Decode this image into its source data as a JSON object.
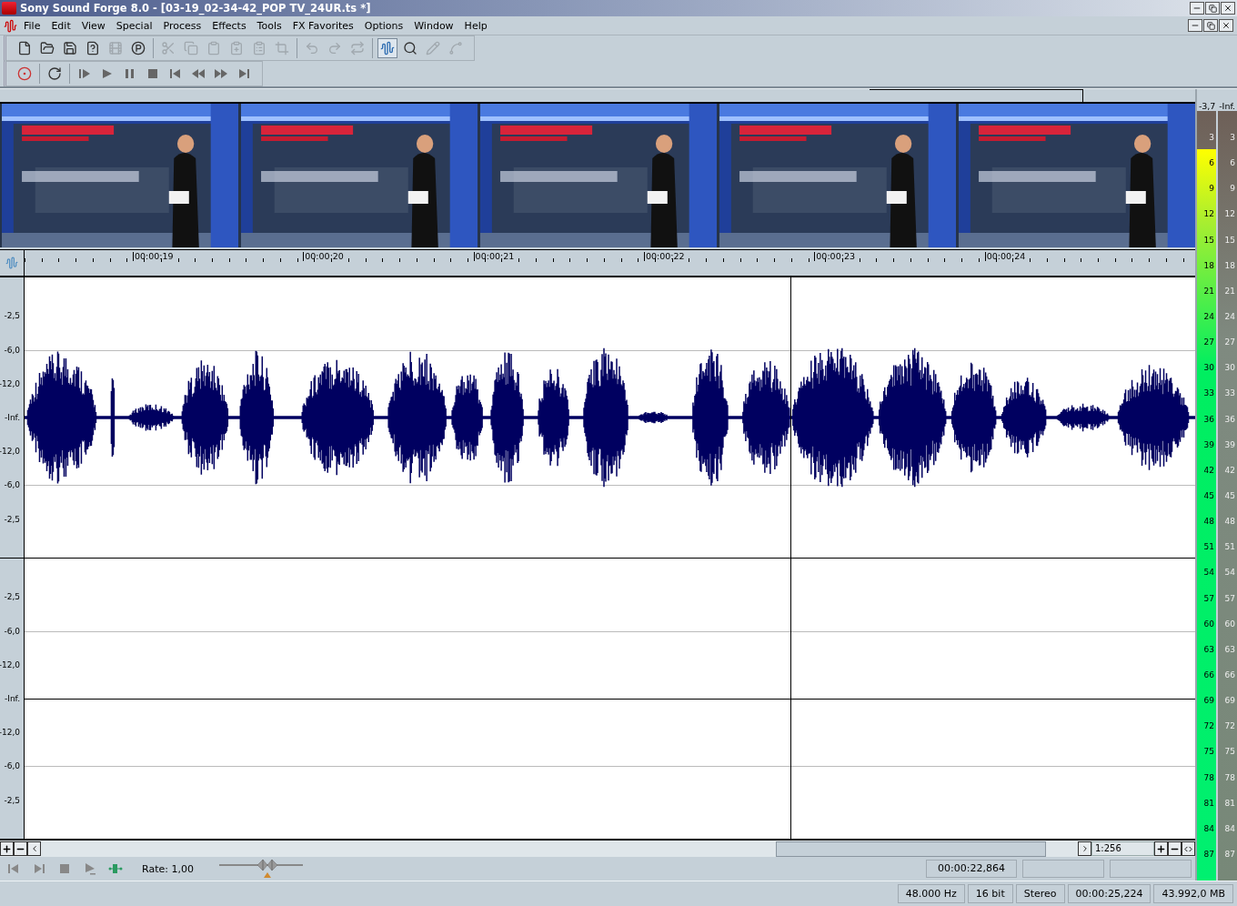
{
  "title_bar": {
    "title": "Sony Sound Forge 8.0 - [03-19_02-34-42_POP TV_24UR.ts *]"
  },
  "menu": [
    "File",
    "Edit",
    "View",
    "Special",
    "Process",
    "Effects",
    "Tools",
    "FX Favorites",
    "Options",
    "Window",
    "Help"
  ],
  "toolbar_rows": [
    [
      {
        "kind": "buttons",
        "items": [
          {
            "kind": "new",
            "disabled": false
          },
          {
            "kind": "open",
            "disabled": false
          },
          {
            "kind": "save",
            "disabled": false
          },
          {
            "kind": "saveas",
            "disabled": false
          },
          {
            "kind": "render",
            "disabled": true
          },
          {
            "kind": "properties",
            "disabled": false
          }
        ]
      },
      {
        "kind": "buttons",
        "items": [
          {
            "kind": "cut",
            "disabled": true
          },
          {
            "kind": "copy",
            "disabled": true
          },
          {
            "kind": "paste",
            "disabled": true
          },
          {
            "kind": "pastemix",
            "disabled": true
          },
          {
            "kind": "pastecross",
            "disabled": true
          },
          {
            "kind": "trim",
            "disabled": true
          }
        ]
      },
      {
        "kind": "buttons",
        "items": [
          {
            "kind": "undo",
            "disabled": true
          },
          {
            "kind": "redo",
            "disabled": true
          },
          {
            "kind": "repeat",
            "disabled": true
          }
        ]
      },
      {
        "kind": "tools",
        "items": [
          {
            "kind": "edit",
            "disabled": false,
            "selected": true
          },
          {
            "kind": "magnify",
            "disabled": false,
            "selected": false
          },
          {
            "kind": "pencil",
            "disabled": true,
            "selected": false
          },
          {
            "kind": "envelope",
            "disabled": true,
            "selected": false
          }
        ]
      }
    ],
    [
      {
        "kind": "buttons",
        "items": [
          {
            "kind": "record",
            "disabled": false
          }
        ]
      },
      {
        "kind": "buttons",
        "items": [
          {
            "kind": "loop",
            "disabled": false
          }
        ]
      },
      {
        "kind": "buttons",
        "items": [
          {
            "kind": "playall",
            "disabled": false
          },
          {
            "kind": "play",
            "disabled": false
          },
          {
            "kind": "pause",
            "disabled": false
          },
          {
            "kind": "stop",
            "disabled": false
          },
          {
            "kind": "start",
            "disabled": false
          },
          {
            "kind": "rewind",
            "disabled": false
          },
          {
            "kind": "forward",
            "disabled": false
          },
          {
            "kind": "end",
            "disabled": false
          }
        ]
      }
    ]
  ],
  "video_frames": [
    {
      "kind": "picture"
    },
    {
      "kind": "picture"
    },
    {
      "kind": "picture"
    },
    {
      "kind": "picture"
    },
    {
      "kind": "picture"
    }
  ],
  "ruler": {
    "labels": [
      "00:00:19",
      "00:00:20",
      "00:00:21",
      "00:00:22",
      "00:00:23",
      "00:00:24"
    ]
  },
  "channels": [
    {
      "kind": "waveform",
      "axis_labels": [
        "-2,5",
        "-6,0",
        "-12,0",
        "-Inf.",
        "-12,0",
        "-6,0",
        "-2,5"
      ]
    },
    {
      "kind": "empty",
      "axis_labels": [
        "-2,5",
        "-6,0",
        "-12,0",
        "-Inf.",
        "-12,0",
        "-6,0",
        "-2,5"
      ]
    }
  ],
  "scroll_bar": {
    "zoom_ratio": "1:256"
  },
  "transport": {
    "buttons": [
      {
        "kind": "start"
      },
      {
        "kind": "end"
      },
      {
        "kind": "stop"
      },
      {
        "kind": "playnormal"
      },
      {
        "kind": "scrub"
      }
    ],
    "rate_label": "Rate: 1,00",
    "rate_slider": {
      "level": 0.58
    },
    "cursor_time": "00:00:22,864"
  },
  "status_bar": [
    "48.000 Hz",
    "16 bit",
    "Stereo",
    "00:00:25,224",
    "43.992,0 MB"
  ],
  "meters": {
    "peaks": [
      "-3,7",
      "-Inf."
    ],
    "channels": [
      {
        "level": 0.95,
        "scale": [
          "3",
          "6",
          "9",
          "12",
          "15",
          "18",
          "21",
          "24",
          "27",
          "30",
          "33",
          "36",
          "39",
          "42",
          "45",
          "48",
          "51",
          "54",
          "57",
          "60",
          "63",
          "66",
          "69",
          "72",
          "75",
          "78",
          "81",
          "84",
          "87"
        ]
      },
      {
        "level": 0,
        "scale": [
          "3",
          "6",
          "9",
          "12",
          "15",
          "18",
          "21",
          "24",
          "27",
          "30",
          "33",
          "36",
          "39",
          "42",
          "45",
          "48",
          "51",
          "54",
          "57",
          "60",
          "63",
          "66",
          "69",
          "72",
          "75",
          "78",
          "81",
          "84",
          "87"
        ]
      }
    ]
  }
}
